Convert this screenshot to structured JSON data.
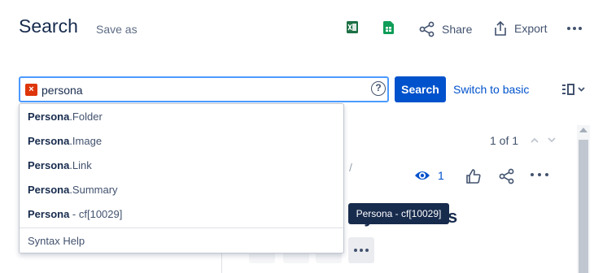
{
  "header": {
    "title": "Search",
    "save_as": "Save as",
    "share_label": "Share",
    "export_label": "Export"
  },
  "search": {
    "query": "persona",
    "button_label": "Search",
    "switch_label": "Switch to basic"
  },
  "suggestions": [
    {
      "bold": "Persona",
      "rest": ".Folder"
    },
    {
      "bold": "Persona",
      "rest": ".Image"
    },
    {
      "bold": "Persona",
      "rest": ".Link"
    },
    {
      "bold": "Persona",
      "rest": ".Summary"
    },
    {
      "bold": "Persona",
      "rest": " - cf[10029]"
    }
  ],
  "syntax_help": "Syntax Help",
  "tooltip": "Persona - cf[10029]",
  "pager": {
    "text": "1 of 1"
  },
  "issue": {
    "breadcrumb_sep": "/",
    "watch_count": "1",
    "title_fragment": "ty accounts"
  },
  "colors": {
    "primary": "#0052cc",
    "focus": "#4c9aff",
    "error": "#de350b",
    "excel": "#1d7044",
    "sheets": "#0f9d58",
    "tooltip_bg": "#172b4d"
  },
  "icons": [
    "excel-icon",
    "google-sheets-icon",
    "share-icon",
    "export-icon",
    "more-icon",
    "clear-icon",
    "help-icon",
    "view-toggle-icon",
    "chevron-up-icon",
    "chevron-down-icon",
    "eye-icon",
    "like-icon"
  ]
}
